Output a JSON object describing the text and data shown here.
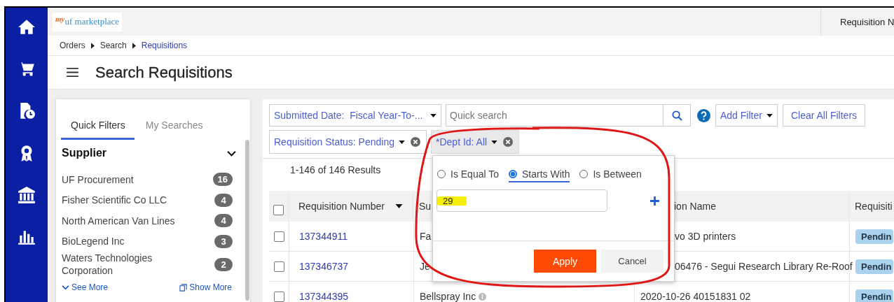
{
  "header": {
    "logo_prefix": "my",
    "logo": "uf marketplace",
    "right_text": "Requisition N"
  },
  "breadcrumb": [
    {
      "label": "Orders",
      "selected": false
    },
    {
      "label": "Search",
      "selected": false
    },
    {
      "label": "Requisitions",
      "selected": true
    }
  ],
  "page_title": "Search Requisitions",
  "side_panel": {
    "tabs": [
      {
        "label": "Quick Filters",
        "selected": true
      },
      {
        "label": "My Searches",
        "selected": false
      }
    ],
    "section": {
      "title": "Supplier",
      "expanded": true
    },
    "items": [
      {
        "name": "UF Procurement",
        "count": "16"
      },
      {
        "name": "Fisher Scientific Co LLC",
        "count": "4"
      },
      {
        "name": "North American Van Lines",
        "count": "4"
      },
      {
        "name": "BioLegend Inc",
        "count": "3"
      },
      {
        "name": "Waters Technologies Corporation",
        "count": "2"
      }
    ],
    "see_more": "See More",
    "show_more": "Show More"
  },
  "filters": {
    "date_filter": {
      "label": "Submitted Date:",
      "value": "Fiscal Year-To-..."
    },
    "search": {
      "placeholder": "Quick search"
    },
    "add_filter": "Add Filter",
    "clear_filters": "Clear All Filters",
    "chips": [
      {
        "label": "Requisition Status: Pending",
        "selected": false
      },
      {
        "label": "*Dept Id: All",
        "selected": true
      }
    ]
  },
  "results": "1-146 of 146 Results",
  "table": {
    "all_checked": false,
    "columns": [
      {
        "label": "Requisition Number",
        "sorted": true
      },
      {
        "label": "Su",
        "sorted": false
      },
      {
        "label": "ion Name",
        "sorted": false
      },
      {
        "label": "Requisiti",
        "sorted": false
      }
    ],
    "rows": [
      {
        "checked": false,
        "number": "137344911",
        "supplier": "Fa",
        "info": false,
        "name": "vo 3D printers",
        "status": "Pendin"
      },
      {
        "checked": false,
        "number": "137346737",
        "supplier": "Je",
        "info": false,
        "name": "06476 - Segui Research Library Re-Roof",
        "status": "Pendin"
      },
      {
        "checked": false,
        "number": "137344395",
        "supplier": "Bellspray Inc",
        "info": true,
        "name": "2020-10-26 40151831 02",
        "status": "Pendin"
      }
    ]
  },
  "popup": {
    "options": [
      {
        "label": "Is Equal To",
        "selected": false
      },
      {
        "label": "Starts With",
        "selected": true
      },
      {
        "label": "Is Between",
        "selected": false
      }
    ],
    "value": "29",
    "apply": "Apply",
    "cancel": "Cancel"
  }
}
